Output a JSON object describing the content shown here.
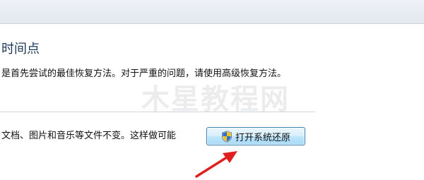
{
  "section": {
    "heading": "时间点",
    "description": "是首先尝试的最佳恢复方法。对于严重的问题，请使用高级恢复方法。"
  },
  "restore": {
    "description": "文档、图片和音乐等文件不变。这样做可能",
    "button_label": "打开系统还原",
    "button_icon": "uac-shield-icon"
  },
  "watermark": {
    "text": "木星教程网"
  },
  "annotation": {
    "arrow_color": "#e02020"
  }
}
